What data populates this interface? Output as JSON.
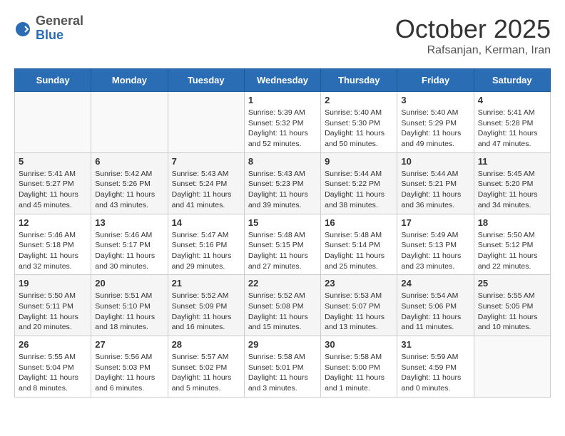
{
  "header": {
    "logo_general": "General",
    "logo_blue": "Blue",
    "month_title": "October 2025",
    "subtitle": "Rafsanjan, Kerman, Iran"
  },
  "weekdays": [
    "Sunday",
    "Monday",
    "Tuesday",
    "Wednesday",
    "Thursday",
    "Friday",
    "Saturday"
  ],
  "weeks": [
    [
      {
        "day": "",
        "info": ""
      },
      {
        "day": "",
        "info": ""
      },
      {
        "day": "",
        "info": ""
      },
      {
        "day": "1",
        "sunrise": "5:39 AM",
        "sunset": "5:32 PM",
        "daylight": "11 hours and 52 minutes."
      },
      {
        "day": "2",
        "sunrise": "5:40 AM",
        "sunset": "5:30 PM",
        "daylight": "11 hours and 50 minutes."
      },
      {
        "day": "3",
        "sunrise": "5:40 AM",
        "sunset": "5:29 PM",
        "daylight": "11 hours and 49 minutes."
      },
      {
        "day": "4",
        "sunrise": "5:41 AM",
        "sunset": "5:28 PM",
        "daylight": "11 hours and 47 minutes."
      }
    ],
    [
      {
        "day": "5",
        "sunrise": "5:41 AM",
        "sunset": "5:27 PM",
        "daylight": "11 hours and 45 minutes."
      },
      {
        "day": "6",
        "sunrise": "5:42 AM",
        "sunset": "5:26 PM",
        "daylight": "11 hours and 43 minutes."
      },
      {
        "day": "7",
        "sunrise": "5:43 AM",
        "sunset": "5:24 PM",
        "daylight": "11 hours and 41 minutes."
      },
      {
        "day": "8",
        "sunrise": "5:43 AM",
        "sunset": "5:23 PM",
        "daylight": "11 hours and 39 minutes."
      },
      {
        "day": "9",
        "sunrise": "5:44 AM",
        "sunset": "5:22 PM",
        "daylight": "11 hours and 38 minutes."
      },
      {
        "day": "10",
        "sunrise": "5:44 AM",
        "sunset": "5:21 PM",
        "daylight": "11 hours and 36 minutes."
      },
      {
        "day": "11",
        "sunrise": "5:45 AM",
        "sunset": "5:20 PM",
        "daylight": "11 hours and 34 minutes."
      }
    ],
    [
      {
        "day": "12",
        "sunrise": "5:46 AM",
        "sunset": "5:18 PM",
        "daylight": "11 hours and 32 minutes."
      },
      {
        "day": "13",
        "sunrise": "5:46 AM",
        "sunset": "5:17 PM",
        "daylight": "11 hours and 30 minutes."
      },
      {
        "day": "14",
        "sunrise": "5:47 AM",
        "sunset": "5:16 PM",
        "daylight": "11 hours and 29 minutes."
      },
      {
        "day": "15",
        "sunrise": "5:48 AM",
        "sunset": "5:15 PM",
        "daylight": "11 hours and 27 minutes."
      },
      {
        "day": "16",
        "sunrise": "5:48 AM",
        "sunset": "5:14 PM",
        "daylight": "11 hours and 25 minutes."
      },
      {
        "day": "17",
        "sunrise": "5:49 AM",
        "sunset": "5:13 PM",
        "daylight": "11 hours and 23 minutes."
      },
      {
        "day": "18",
        "sunrise": "5:50 AM",
        "sunset": "5:12 PM",
        "daylight": "11 hours and 22 minutes."
      }
    ],
    [
      {
        "day": "19",
        "sunrise": "5:50 AM",
        "sunset": "5:11 PM",
        "daylight": "11 hours and 20 minutes."
      },
      {
        "day": "20",
        "sunrise": "5:51 AM",
        "sunset": "5:10 PM",
        "daylight": "11 hours and 18 minutes."
      },
      {
        "day": "21",
        "sunrise": "5:52 AM",
        "sunset": "5:09 PM",
        "daylight": "11 hours and 16 minutes."
      },
      {
        "day": "22",
        "sunrise": "5:52 AM",
        "sunset": "5:08 PM",
        "daylight": "11 hours and 15 minutes."
      },
      {
        "day": "23",
        "sunrise": "5:53 AM",
        "sunset": "5:07 PM",
        "daylight": "11 hours and 13 minutes."
      },
      {
        "day": "24",
        "sunrise": "5:54 AM",
        "sunset": "5:06 PM",
        "daylight": "11 hours and 11 minutes."
      },
      {
        "day": "25",
        "sunrise": "5:55 AM",
        "sunset": "5:05 PM",
        "daylight": "11 hours and 10 minutes."
      }
    ],
    [
      {
        "day": "26",
        "sunrise": "5:55 AM",
        "sunset": "5:04 PM",
        "daylight": "11 hours and 8 minutes."
      },
      {
        "day": "27",
        "sunrise": "5:56 AM",
        "sunset": "5:03 PM",
        "daylight": "11 hours and 6 minutes."
      },
      {
        "day": "28",
        "sunrise": "5:57 AM",
        "sunset": "5:02 PM",
        "daylight": "11 hours and 5 minutes."
      },
      {
        "day": "29",
        "sunrise": "5:58 AM",
        "sunset": "5:01 PM",
        "daylight": "11 hours and 3 minutes."
      },
      {
        "day": "30",
        "sunrise": "5:58 AM",
        "sunset": "5:00 PM",
        "daylight": "11 hours and 1 minute."
      },
      {
        "day": "31",
        "sunrise": "5:59 AM",
        "sunset": "4:59 PM",
        "daylight": "11 hours and 0 minutes."
      },
      {
        "day": "",
        "info": ""
      }
    ]
  ],
  "labels": {
    "sunrise": "Sunrise:",
    "sunset": "Sunset:",
    "daylight": "Daylight hours"
  }
}
